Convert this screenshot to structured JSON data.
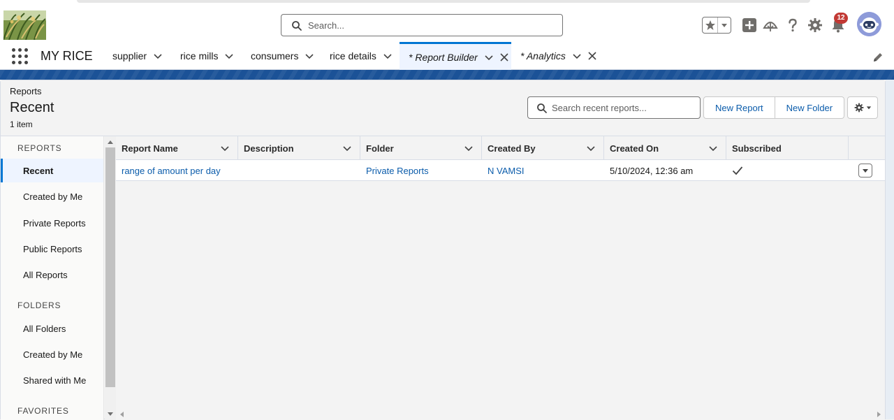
{
  "header": {
    "search_placeholder": "Search...",
    "notification_count": "12"
  },
  "nav": {
    "app_name": "MY RICE",
    "tabs": [
      {
        "label": "supplier"
      },
      {
        "label": "rice mills"
      },
      {
        "label": "consumers"
      },
      {
        "label": "rice details"
      },
      {
        "label": "* Report Builder",
        "active": true,
        "closable": true
      },
      {
        "label": "* Analytics",
        "closable": true
      }
    ]
  },
  "page": {
    "eyebrow": "Reports",
    "title": "Recent",
    "item_count": "1 item",
    "search_placeholder": "Search recent reports...",
    "new_report_label": "New Report",
    "new_folder_label": "New Folder"
  },
  "sidebar": {
    "reports_heading": "REPORTS",
    "report_items": [
      {
        "label": "Recent",
        "active": true
      },
      {
        "label": "Created by Me"
      },
      {
        "label": "Private Reports"
      },
      {
        "label": "Public Reports"
      },
      {
        "label": "All Reports"
      }
    ],
    "folders_heading": "FOLDERS",
    "folder_items": [
      {
        "label": "All Folders"
      },
      {
        "label": "Created by Me"
      },
      {
        "label": "Shared with Me"
      }
    ],
    "favorites_heading": "FAVORITES"
  },
  "table": {
    "columns": [
      "Report Name",
      "Description",
      "Folder",
      "Created By",
      "Created On",
      "Subscribed"
    ],
    "rows": [
      {
        "report_name": "range of amount per day",
        "description": "",
        "folder": "Private Reports",
        "created_by": "N VAMSI",
        "created_on": "5/10/2024, 12:36 am",
        "subscribed": true
      }
    ]
  },
  "colors": {
    "brand_band": "#1b5297",
    "link": "#0b5cab",
    "active_accent": "#0176d3",
    "badge": "#c23934"
  }
}
